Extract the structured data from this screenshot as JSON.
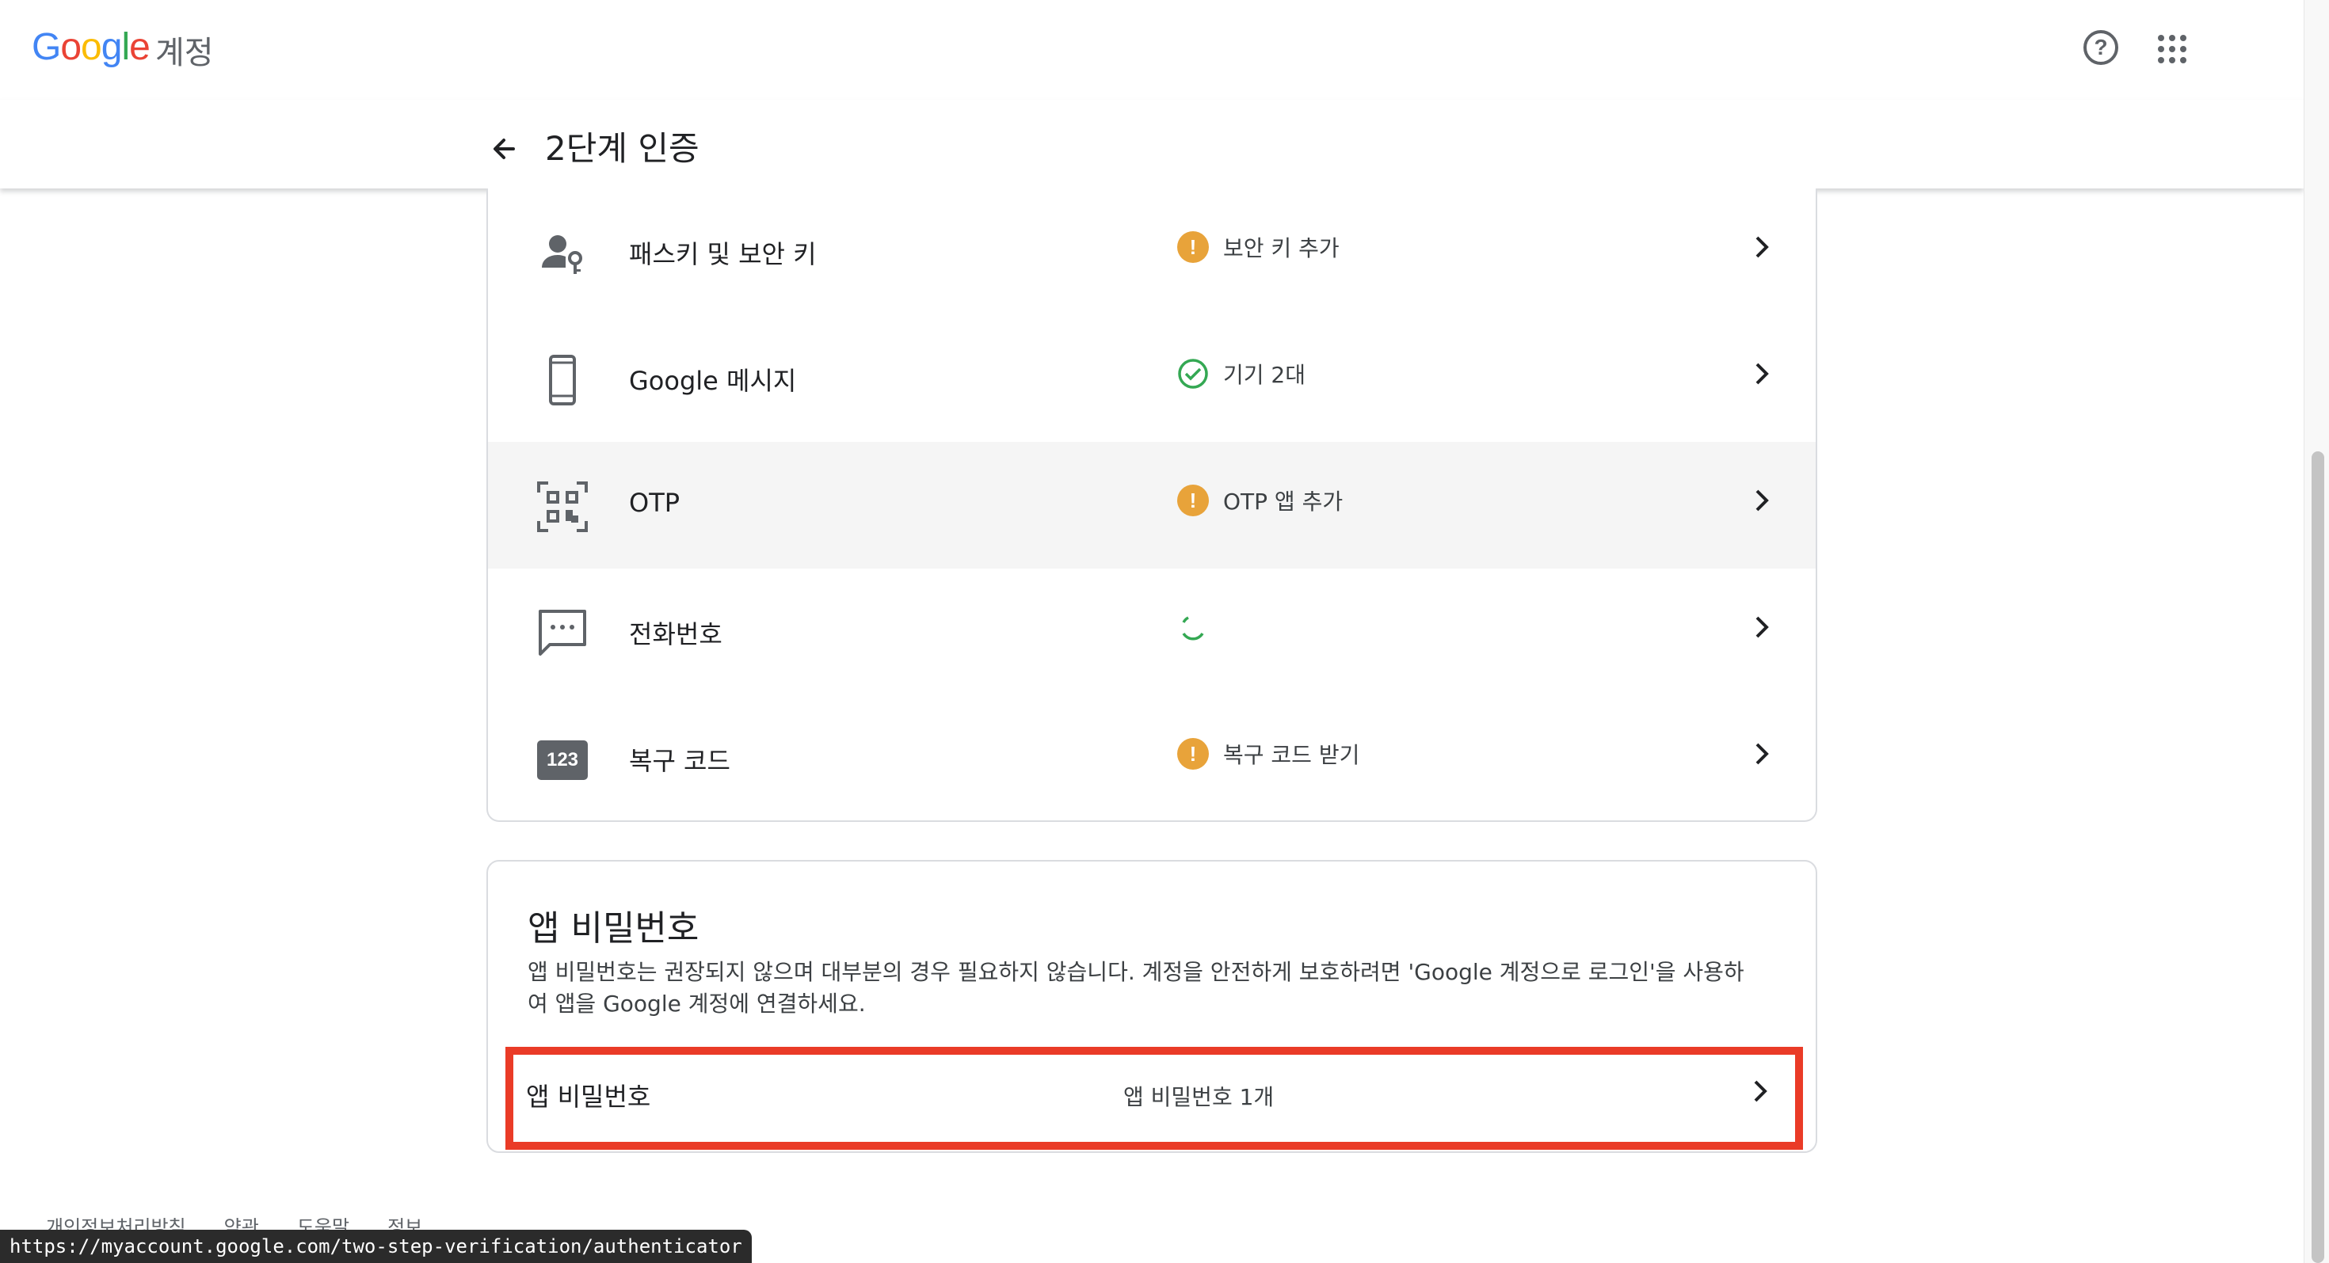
{
  "header": {
    "logo_letters": [
      "G",
      "o",
      "o",
      "g",
      "l",
      "e"
    ],
    "product_name": "계정",
    "help_icon": "help-circle-icon",
    "apps_icon": "apps-grid-icon"
  },
  "subheader": {
    "title": "2단계 인증",
    "back_icon": "arrow-back-icon"
  },
  "methods": [
    {
      "label": "패스키 및 보안 키",
      "status": "보안 키 추가",
      "status_icon": "warning-icon",
      "icon": "passkey-icon"
    },
    {
      "label": "Google 메시지",
      "status": "기기 2대",
      "status_icon": "check-circle-icon",
      "icon": "phone-icon"
    },
    {
      "label": "OTP",
      "status": "OTP 앱 추가",
      "status_icon": "warning-icon",
      "icon": "qr-code-icon"
    },
    {
      "label": "전화번호",
      "status": "",
      "status_icon": "loading-spinner-icon",
      "icon": "sms-icon"
    },
    {
      "label": "복구 코드",
      "status": "복구 코드 받기",
      "status_icon": "warning-icon",
      "icon": "backup-codes-icon",
      "badge": "123"
    }
  ],
  "app_passwords": {
    "title": "앱 비밀번호",
    "description": "앱 비밀번호는 권장되지 않으며 대부분의 경우 필요하지 않습니다. 계정을 안전하게 보호하려면 'Google 계정으로 로그인'을 사용하여 앱을 Google 계정에 연결하세요.",
    "row_label": "앱 비밀번호",
    "row_value": "앱 비밀번호 1개"
  },
  "footer": {
    "links": [
      "개인정보처리방침",
      "약관",
      "도움말",
      "정보"
    ]
  },
  "status_url": "https://myaccount.google.com/two-step-verification/authenticator",
  "colors": {
    "warning": "#e8a33a",
    "success": "#34a853",
    "highlight_border": "#ea3b27",
    "hover_row": "#f5f5f5"
  }
}
